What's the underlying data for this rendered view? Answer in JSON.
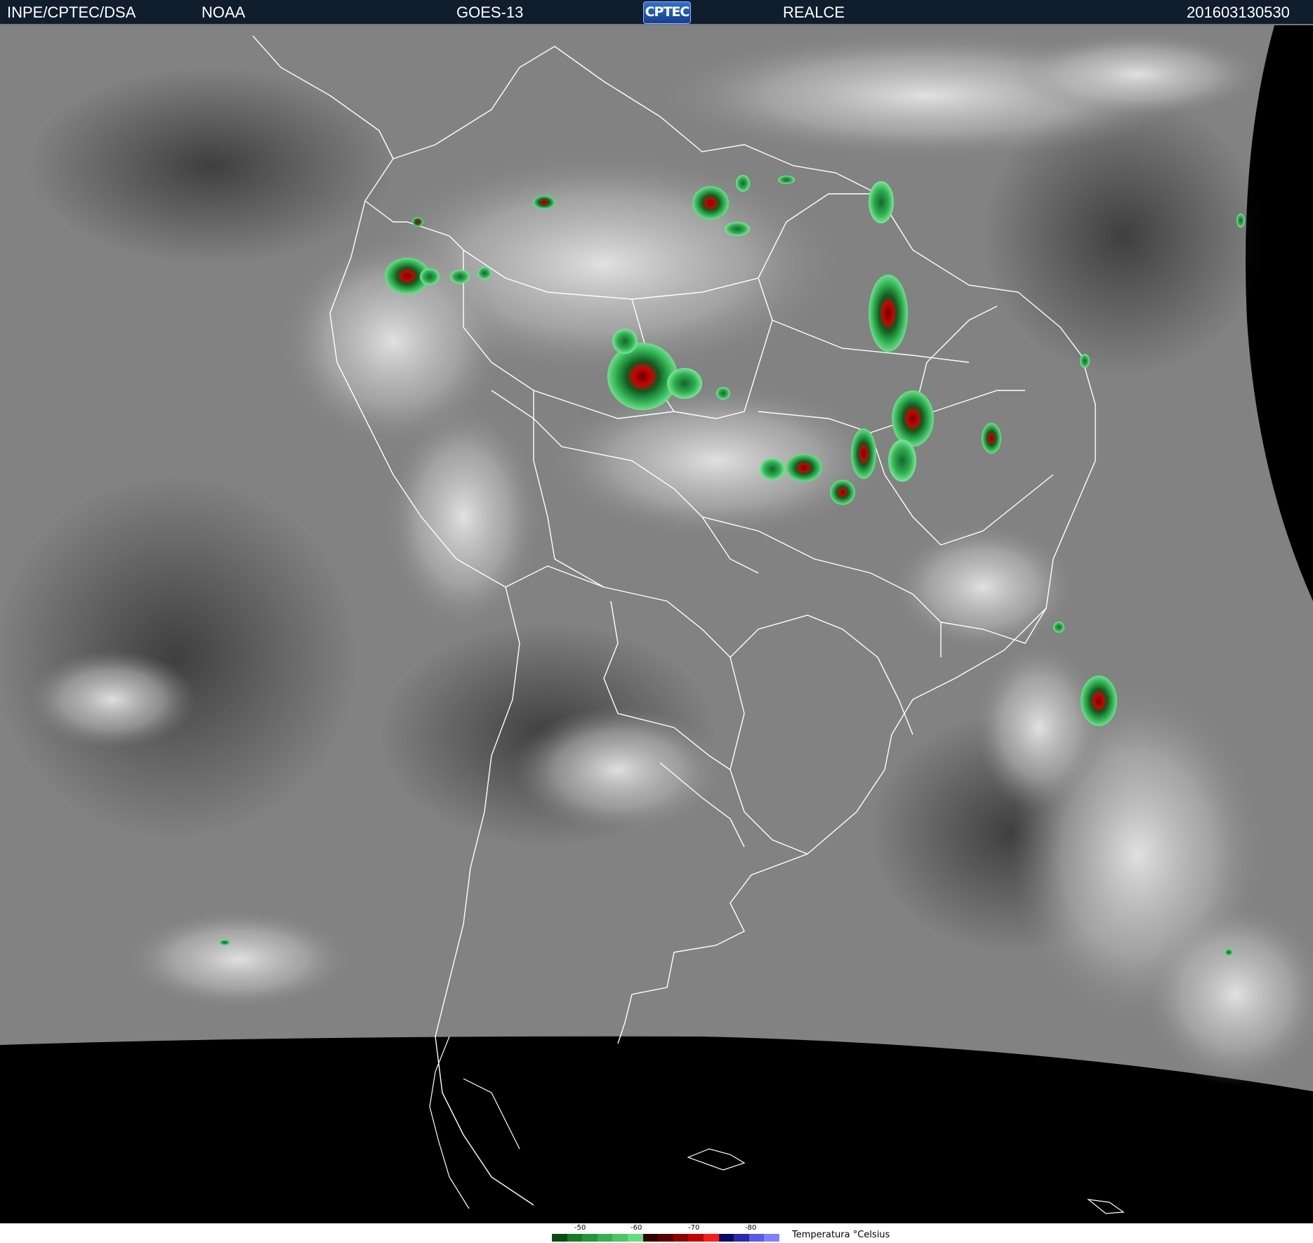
{
  "header": {
    "agency": "INPE/CPTEC/DSA",
    "partner": "NOAA",
    "satellite": "GOES-13",
    "logo_text": "CPTEC",
    "product": "REALCE",
    "timestamp": "201603130530"
  },
  "map": {
    "icon": "satellite-image",
    "background_color": "#000000",
    "cloud_gray": "#8a8a8a",
    "border_color": "#ffffff",
    "storm_colors": [
      "#0f5a1e",
      "#27a047",
      "#5ee07a",
      "#5a0000",
      "#c80000",
      "#ff2a2a"
    ]
  },
  "legend": {
    "title": "Temperatura  °Celsius",
    "ticks": [
      "-50",
      "-60",
      "-70",
      "-80"
    ],
    "colors": [
      "#0a4b14",
      "#167a28",
      "#23963a",
      "#34b04e",
      "#4ac764",
      "#66dc80",
      "#330000",
      "#5a0000",
      "#8e0000",
      "#c40000",
      "#ff1a1a",
      "#0a0a66",
      "#2a2ab0",
      "#5a5aee",
      "#8080ff"
    ]
  }
}
